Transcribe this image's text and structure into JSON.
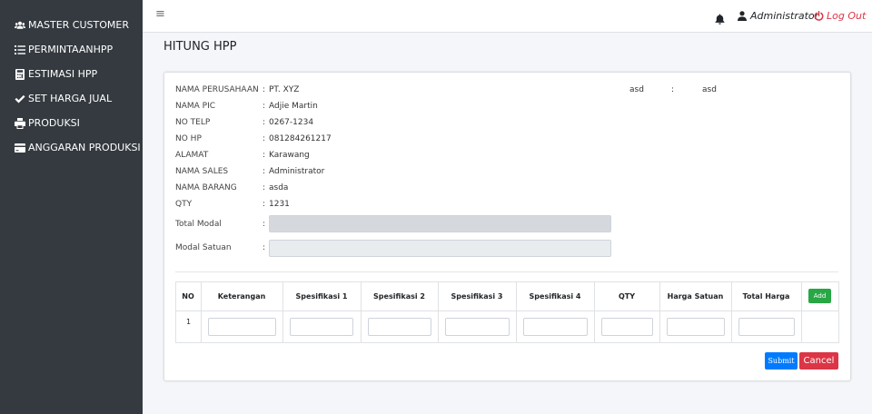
{
  "sidebar": {
    "items": [
      {
        "label": "MASTER CUSTOMER",
        "icon": "users-icon"
      },
      {
        "label": "PERMINTAANHPP",
        "icon": "list-icon"
      },
      {
        "label": "ESTIMASI HPP",
        "icon": "calculator-icon"
      },
      {
        "label": "SET HARGA JUAL",
        "icon": "check-icon"
      },
      {
        "label": "PRODUKSI",
        "icon": "print-icon"
      },
      {
        "label": "ANGGARAN PRODUKSI",
        "icon": "credit-card-icon"
      }
    ]
  },
  "navbar": {
    "menu_icon": "≡",
    "user": "Administrator",
    "logout": "Log Out"
  },
  "page": {
    "title": "HITUNG HPP"
  },
  "info": {
    "colon": ":",
    "fields": [
      {
        "label": "NAMA PERUSAHAAN",
        "value": "PT. XYZ"
      },
      {
        "label": "NAMA PIC",
        "value": "Adjie Martin"
      },
      {
        "label": "NO TELP",
        "value": "0267-1234"
      },
      {
        "label": "NO HP",
        "value": "081284261217"
      },
      {
        "label": "ALAMAT",
        "value": "Karawang"
      },
      {
        "label": "NAMA SALES",
        "value": "Administrator"
      },
      {
        "label": "NAMA BARANG",
        "value": "asda"
      },
      {
        "label": "QTY",
        "value": "1231"
      }
    ],
    "extra": {
      "label": "asd",
      "value": "asd"
    }
  },
  "totals": {
    "total_modal_label": "Total Modal",
    "modal_satuan_label": "Modal Satuan"
  },
  "table": {
    "headers": [
      "NO",
      "Keterangan",
      "Spesifikasi 1",
      "Spesifikasi 2",
      "Spesifikasi 3",
      "Spesifikasi 4",
      "QTY",
      "Harga Satuan",
      "Total Harga"
    ],
    "rows": [
      {
        "no": "1"
      }
    ],
    "add_label": "Add"
  },
  "actions": {
    "submit": "Submit",
    "cancel": "Cancel"
  },
  "colors": {
    "sidebar": "#343a40",
    "primary": "#007bff",
    "success": "#28a745",
    "danger": "#dc3545"
  }
}
